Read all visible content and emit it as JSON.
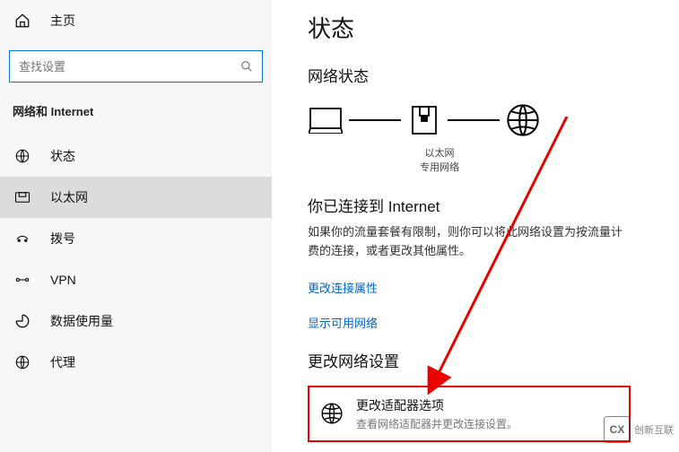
{
  "sidebar": {
    "home": "主页",
    "search_placeholder": "查找设置",
    "section": "网络和 Internet",
    "items": [
      {
        "label": "状态"
      },
      {
        "label": "以太网"
      },
      {
        "label": "拨号"
      },
      {
        "label": "VPN"
      },
      {
        "label": "数据使用量"
      },
      {
        "label": "代理"
      }
    ]
  },
  "main": {
    "title": "状态",
    "network_status": "网络状态",
    "diagram_caption_line1": "以太网",
    "diagram_caption_line2": "专用网络",
    "connected_title": "你已连接到 Internet",
    "connected_desc": "如果你的流量套餐有限制，则你可以将此网络设置为按流量计费的连接，或者更改其他属性。",
    "link_props": "更改连接属性",
    "link_avail": "显示可用网络",
    "change_title": "更改网络设置",
    "adapter_title": "更改适配器选项",
    "adapter_desc": "查看网络适配器并更改连接设置。"
  },
  "watermark": {
    "brand": "创新互联"
  }
}
